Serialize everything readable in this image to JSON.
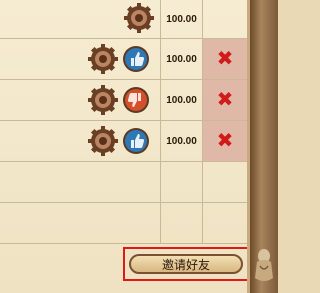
{
  "rows": [
    {
      "score": "100.00",
      "badge": "none",
      "remove_icon": "none"
    },
    {
      "score": "100.00",
      "badge": "thumbs-up",
      "remove_icon": "x-mark"
    },
    {
      "score": "100.00",
      "badge": "thumbs-down",
      "remove_icon": "x-mark"
    },
    {
      "score": "100.00",
      "badge": "thumbs-up",
      "remove_icon": "x-mark"
    }
  ],
  "remove_symbol": "✖",
  "invite_button": {
    "label": "邀请好友"
  },
  "colors": {
    "highlight_border": "#e01818",
    "remove_icon": "#d11a1a",
    "thumbs_up_badge": "#2f78b6",
    "thumbs_down_badge": "#d4502c"
  }
}
